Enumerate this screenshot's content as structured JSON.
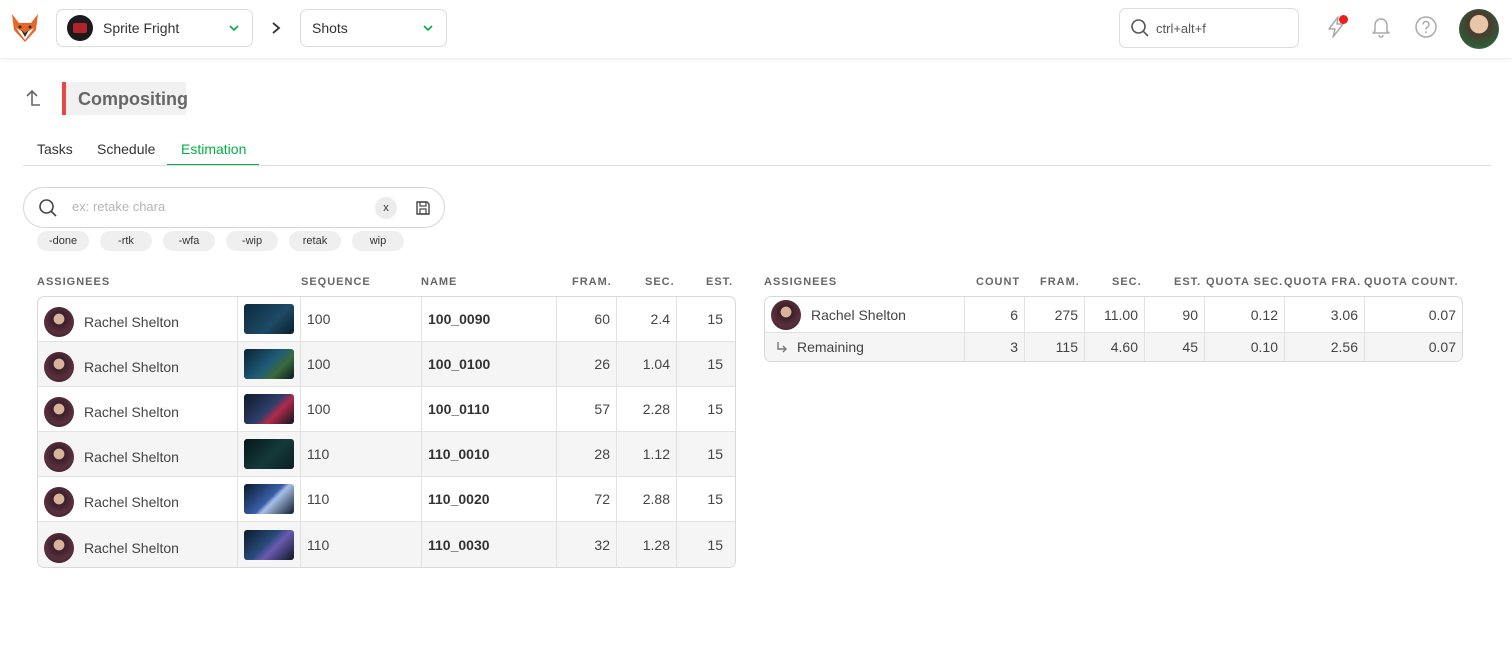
{
  "colors": {
    "accent": "#00b242",
    "dept": "#e94646",
    "notification": "#ee1c1c"
  },
  "topbar": {
    "production": "Sprite Fright",
    "section": "Shots",
    "search_placeholder": "ctrl+alt+f",
    "icons": [
      "lightning-icon",
      "bell-icon",
      "help-icon"
    ]
  },
  "page": {
    "department": "Compositing",
    "tabs": [
      "Tasks",
      "Schedule",
      "Estimation"
    ],
    "active_tab": "Estimation"
  },
  "search": {
    "placeholder": "ex: retake chara",
    "clear": "x",
    "chips": [
      "-done",
      "-rtk",
      "-wfa",
      "-wip",
      "retak",
      "wip"
    ]
  },
  "shots_table": {
    "headers": [
      "ASSIGNEES",
      "SEQUENCE",
      "NAME",
      "FRAM.",
      "SEC.",
      "EST."
    ],
    "rows": [
      {
        "assignee": "Rachel Shelton",
        "sequence": "100",
        "name": "100_0090",
        "frames": "60",
        "sec": "2.4",
        "est": "15"
      },
      {
        "assignee": "Rachel Shelton",
        "sequence": "100",
        "name": "100_0100",
        "frames": "26",
        "sec": "1.04",
        "est": "15"
      },
      {
        "assignee": "Rachel Shelton",
        "sequence": "100",
        "name": "100_0110",
        "frames": "57",
        "sec": "2.28",
        "est": "15"
      },
      {
        "assignee": "Rachel Shelton",
        "sequence": "110",
        "name": "110_0010",
        "frames": "28",
        "sec": "1.12",
        "est": "15"
      },
      {
        "assignee": "Rachel Shelton",
        "sequence": "110",
        "name": "110_0020",
        "frames": "72",
        "sec": "2.88",
        "est": "15"
      },
      {
        "assignee": "Rachel Shelton",
        "sequence": "110",
        "name": "110_0030",
        "frames": "32",
        "sec": "1.28",
        "est": "15"
      }
    ]
  },
  "summary_table": {
    "headers": [
      "ASSIGNEES",
      "COUNT",
      "FRAM.",
      "SEC.",
      "EST.",
      "QUOTA SEC.",
      "QUOTA FRA.",
      "QUOTA COUNT."
    ],
    "rows": [
      {
        "assignee": "Rachel Shelton",
        "count": "6",
        "frames": "275",
        "sec": "11.00",
        "est": "90",
        "quota_sec": "0.12",
        "quota_fra": "3.06",
        "quota_count": "0.07"
      },
      {
        "assignee": "Remaining",
        "count": "3",
        "frames": "115",
        "sec": "4.60",
        "est": "45",
        "quota_sec": "0.10",
        "quota_fra": "2.56",
        "quota_count": "0.07"
      }
    ]
  }
}
